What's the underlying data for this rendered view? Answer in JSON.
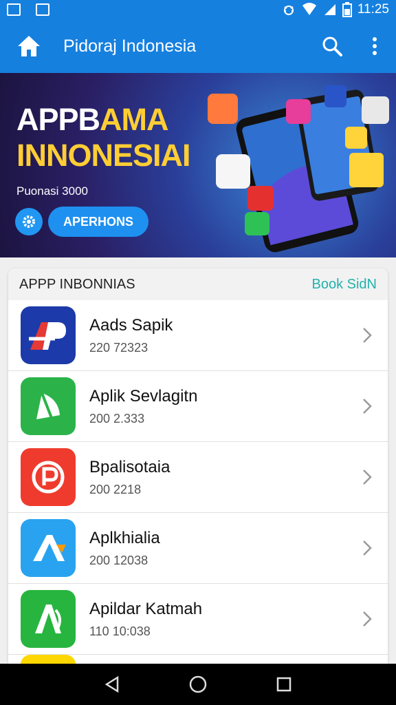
{
  "status_bar": {
    "time": "11:25"
  },
  "app_bar": {
    "title": "Pidoraj Indonesia"
  },
  "banner": {
    "title_line1_a": "APPB",
    "title_line1_b": "AMA",
    "title_line2": "INNONESIAI",
    "subtitle": "Puonasi 3000",
    "button_label": "APERHONS"
  },
  "list": {
    "title": "APPP INBONNIAS",
    "action": "Book SidN",
    "items": [
      {
        "name": "Aads Sapik",
        "sub": "220 72323",
        "icon": "ap-logo-icon",
        "color": "#1c3aa9"
      },
      {
        "name": "Aplik Sevlagitn",
        "sub": "200 2.333",
        "icon": "leaf-logo-icon",
        "color": "#2bb34a"
      },
      {
        "name": "Bpalisotaia",
        "sub": "200 2218",
        "icon": "p-logo-icon",
        "color": "#ef3b2d"
      },
      {
        "name": "Aplkhialia",
        "sub": "200 12038",
        "icon": "a-logo-icon",
        "color": "#29a3f0"
      },
      {
        "name": "Apildar Katmah",
        "sub": "110 10:038",
        "icon": "a-green-logo-icon",
        "color": "#27b53f"
      }
    ]
  }
}
